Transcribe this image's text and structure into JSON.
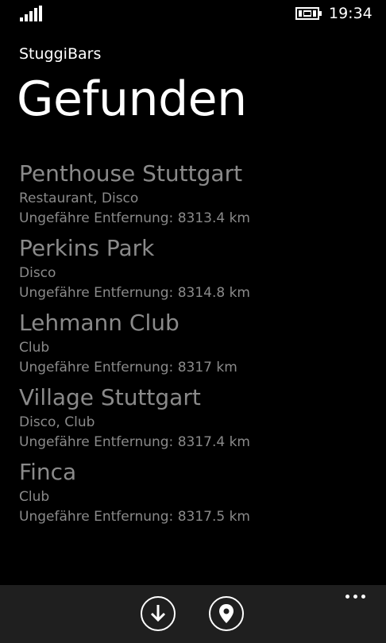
{
  "status_bar": {
    "time": "19:34",
    "signal_icon": "signal-strength-icon",
    "battery_icon": "battery-charging-icon"
  },
  "header": {
    "app_title": "StuggiBars",
    "page_title": "Gefunden"
  },
  "results": [
    {
      "name": "Penthouse Stuttgart",
      "type": "Restaurant, Disco",
      "distance_label": "Ungefähre Entfernung:",
      "distance_value": "8313.4 km"
    },
    {
      "name": "Perkins Park",
      "type": "Disco",
      "distance_label": "Ungefähre Entfernung:",
      "distance_value": "8314.8 km"
    },
    {
      "name": "Lehmann Club",
      "type": "Club",
      "distance_label": "Ungefähre Entfernung:",
      "distance_value": "8317 km"
    },
    {
      "name": "Village Stuttgart",
      "type": "Disco, Club",
      "distance_label": "Ungefähre Entfernung:",
      "distance_value": "8317.4 km"
    },
    {
      "name": "Finca",
      "type": "Club",
      "distance_label": "Ungefähre Entfernung:",
      "distance_value": "8317.5 km"
    }
  ],
  "app_bar": {
    "buttons": [
      {
        "icon": "arrow-down-icon"
      },
      {
        "icon": "map-pin-icon"
      }
    ],
    "more_icon": "more-dots-icon"
  },
  "colors": {
    "background": "#000000",
    "foreground": "#ffffff",
    "list_text": "#8a8a8a",
    "app_bar": "#1f1f1f"
  }
}
